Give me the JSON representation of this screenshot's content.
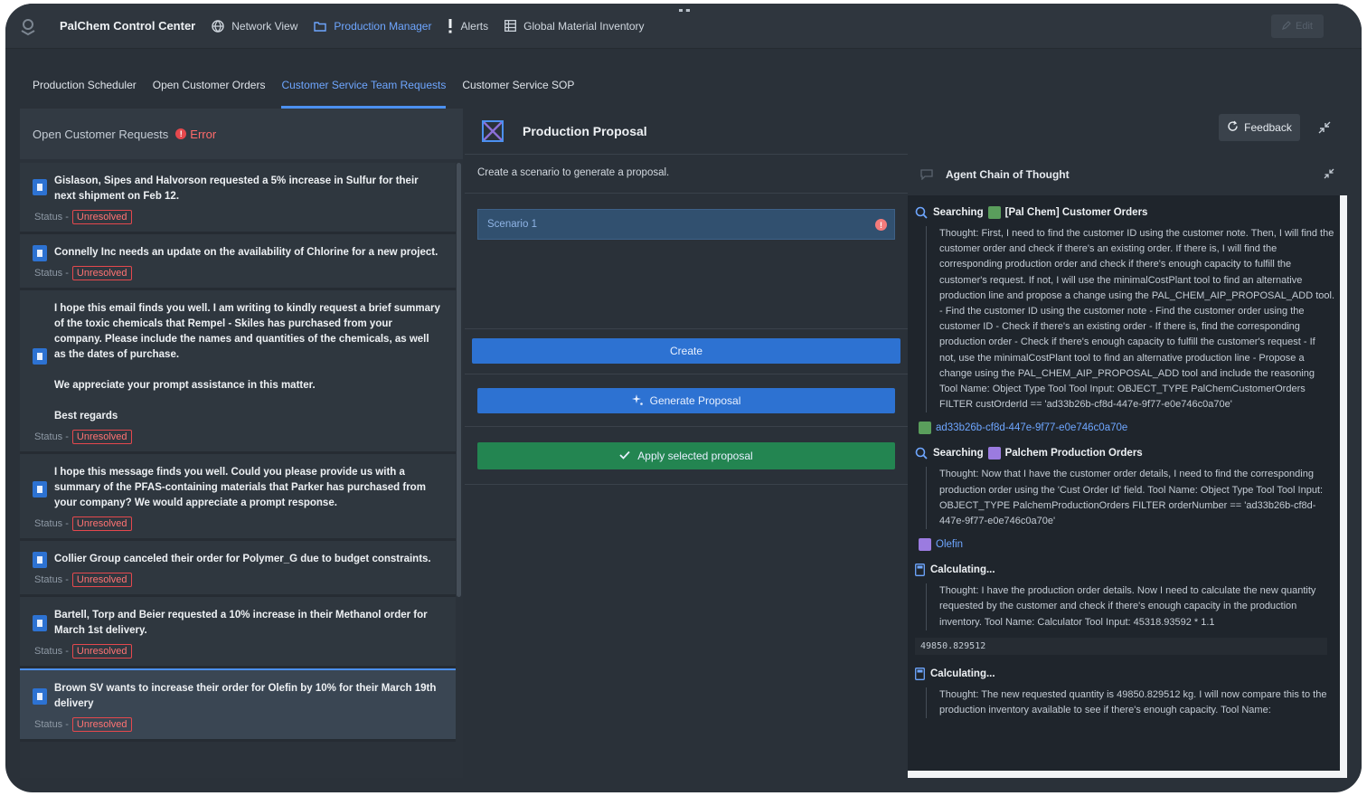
{
  "app": {
    "title": "PalChem Control Center",
    "nav": [
      {
        "label": "Network View",
        "icon": "globe-icon"
      },
      {
        "label": "Production Manager",
        "icon": "folder-icon",
        "active": true
      },
      {
        "label": "Alerts",
        "icon": "exclamation-icon"
      },
      {
        "label": "Global Material Inventory",
        "icon": "grid-icon"
      }
    ],
    "edit_label": "Edit"
  },
  "subtabs": [
    {
      "label": "Production Scheduler"
    },
    {
      "label": "Open Customer Orders"
    },
    {
      "label": "Customer Service Team Requests",
      "active": true
    },
    {
      "label": "Customer Service SOP"
    }
  ],
  "left": {
    "header": "Open Customer Requests",
    "error_label": "Error",
    "status_label": "Status -",
    "requests": [
      {
        "lines": [
          "Gislason, Sipes and Halvorson requested a 5% increase in Sulfur for their next shipment on Feb 12."
        ],
        "status": "Unresolved"
      },
      {
        "lines": [
          "Connelly Inc needs an update on the availability of Chlorine for a new project."
        ],
        "status": "Unresolved"
      },
      {
        "lines": [
          "I hope this email finds you well. I am writing to kindly request a brief summary of the toxic chemicals that Rempel - Skiles has purchased from your company. Please include the names and quantities of the chemicals, as well as the dates of purchase.",
          "We appreciate your prompt assistance in this matter.",
          "Best regards"
        ],
        "status": "Unresolved"
      },
      {
        "lines": [
          "I hope this message finds you well. Could you please provide us with a summary of the PFAS-containing materials that Parker has purchased from your company? We would appreciate a prompt response."
        ],
        "status": "Unresolved"
      },
      {
        "lines": [
          "Collier Group canceled their order for Polymer_G due to budget constraints."
        ],
        "status": "Unresolved"
      },
      {
        "lines": [
          "Bartell, Torp and Beier requested a 10% increase in their Methanol order for March 1st delivery."
        ],
        "status": "Unresolved"
      },
      {
        "lines": [
          "Brown SV wants to increase their order for Olefin by 10% for their March 19th delivery"
        ],
        "status": "Unresolved",
        "selected": true
      }
    ]
  },
  "proposal": {
    "title": "Production Proposal",
    "hint": "Create a scenario to generate a proposal.",
    "scenario_label": "Scenario 1",
    "create_label": "Create",
    "generate_label": "Generate Proposal",
    "apply_label": "Apply selected proposal",
    "feedback_label": "Feedback"
  },
  "cot": {
    "title": "Agent Chain of Thought",
    "searching_label": "Searching",
    "calculating_label": "Calculating...",
    "step1_source": "[Pal Chem] Customer Orders",
    "step1_thought": "Thought: First, I need to find the customer ID using the customer note. Then, I will find the customer order and check if there's an existing order. If there is, I will find the corresponding production order and check if there's enough capacity to fulfill the customer's request. If not, I will use the minimalCostPlant tool to find an alternative production line and propose a change using the PAL_CHEM_AIP_PROPOSAL_ADD tool. - Find the customer ID using the customer note - Find the customer order using the customer ID - Check if there's an existing order - If there is, find the corresponding production order - Check if there's enough capacity to fulfill the customer's request - If not, use the minimalCostPlant tool to find an alternative production line - Propose a change using the PAL_CHEM_AIP_PROPOSAL_ADD tool and include the reasoning Tool Name: Object Type Tool Tool Input: OBJECT_TYPE PalChemCustomerOrders FILTER custOrderId == 'ad33b26b-cf8d-447e-9f77-e0e746c0a70e'",
    "result1": "ad33b26b-cf8d-447e-9f77-e0e746c0a70e",
    "step2_source": "Palchem Production Orders",
    "step2_thought": "Thought: Now that I have the customer order details, I need to find the corresponding production order using the 'Cust Order Id' field. Tool Name: Object Type Tool Tool Input: OBJECT_TYPE PalchemProductionOrders FILTER orderNumber == 'ad33b26b-cf8d-447e-9f77-e0e746c0a70e'",
    "result2": "Olefin",
    "step3_thought": "Thought: I have the production order details. Now I need to calculate the new quantity requested by the customer and check if there's enough capacity in the production inventory. Tool Name: Calculator Tool Input: 45318.93592 * 1.1",
    "result3": "49850.829512",
    "step4_thought": "Thought: The new requested quantity is 49850.829512 kg. I will now compare this to the production inventory available to see if there's enough capacity. Tool Name:"
  },
  "colors": {
    "accent": "#2d72d2",
    "success": "#238551",
    "danger": "#e5484d",
    "background": "#2a3139"
  }
}
